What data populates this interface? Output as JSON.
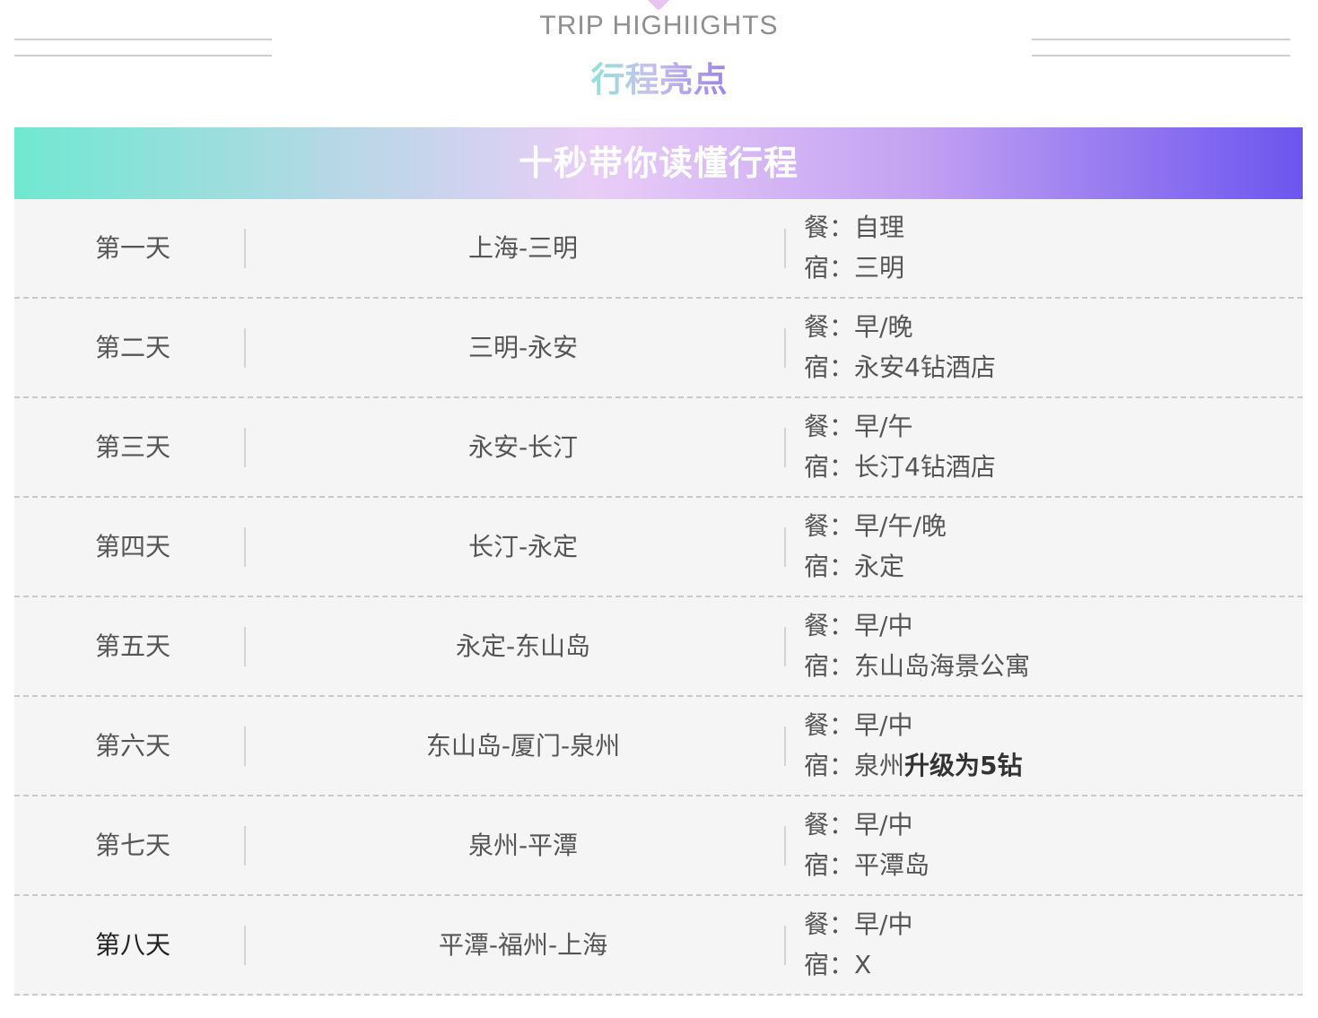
{
  "header": {
    "eng_title": "TRIP HIGHIIGHTS",
    "cn_title": "行程亮点"
  },
  "banner": {
    "title": "十秒带你读懂行程"
  },
  "labels": {
    "meal": "餐：",
    "stay": "宿："
  },
  "itinerary": [
    {
      "day": "第一天",
      "route": "上海-三明",
      "meal": "自理",
      "stay": "三明",
      "stay_bold": ""
    },
    {
      "day": "第二天",
      "route": "三明-永安",
      "meal": "早/晚",
      "stay": "永安4钻酒店",
      "stay_bold": ""
    },
    {
      "day": "第三天",
      "route": "永安-长汀",
      "meal": "早/午",
      "stay": "长汀4钻酒店",
      "stay_bold": ""
    },
    {
      "day": "第四天",
      "route": "长汀-永定",
      "meal": "早/午/晚",
      "stay": "永定",
      "stay_bold": ""
    },
    {
      "day": "第五天",
      "route": "永定-东山岛",
      "meal": "早/中",
      "stay": "东山岛海景公寓",
      "stay_bold": ""
    },
    {
      "day": "第六天",
      "route": "东山岛-厦门-泉州",
      "meal": "早/中",
      "stay": "泉州",
      "stay_bold": "升级为5钻"
    },
    {
      "day": "第七天",
      "route": "泉州-平潭",
      "meal": "早/中",
      "stay": "平潭岛",
      "stay_bold": ""
    },
    {
      "day": "第八天",
      "route": "平潭-福州-上海",
      "meal": "早/中",
      "stay": "X",
      "stay_bold": ""
    }
  ]
}
